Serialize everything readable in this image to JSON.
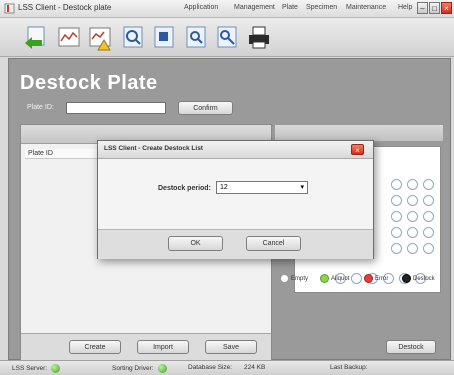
{
  "window": {
    "title": "LSS Client - Destock plate",
    "menu": [
      "Application",
      "Management",
      "Plate",
      "Specimen",
      "Maintenance",
      "Help"
    ],
    "controls": [
      "minimize",
      "maximize",
      "close"
    ]
  },
  "toolbar": {
    "buttons": [
      {
        "icon": "back-icon",
        "label": "Back"
      },
      {
        "icon": "plate-chart-icon",
        "label": "Plate chart"
      },
      {
        "icon": "plate-warning-icon",
        "label": "Plate warning"
      },
      {
        "icon": "search-plate-icon",
        "label": "Search plate"
      },
      {
        "icon": "search-specimen-icon",
        "label": "Search specimen"
      },
      {
        "icon": "search-list-icon",
        "label": "Search list"
      },
      {
        "icon": "search-report-icon",
        "label": "Search report"
      },
      {
        "icon": "printer-icon",
        "label": "Print"
      }
    ]
  },
  "page": {
    "title": "Destock Plate",
    "plate_id_label": "Plate ID:",
    "plate_id_value": "",
    "confirm_label": "Confirm"
  },
  "list": {
    "column_header": "Plate ID",
    "buttons": {
      "create": "Create",
      "import": "Import",
      "save": "Save"
    }
  },
  "plate_view": {
    "legend": [
      {
        "label": "Empty",
        "color": "#ffffff"
      },
      {
        "label": "Aliquot",
        "color": "#8fd14f"
      },
      {
        "label": "Error",
        "color": "#e04040"
      },
      {
        "label": "Destock",
        "color": "#222222"
      }
    ],
    "destock_button": "Destock"
  },
  "dialog": {
    "title": "LSS Client - Create Destock List",
    "destock_period_label": "Destock period:",
    "destock_period_value": "12",
    "ok_label": "OK",
    "cancel_label": "Cancel"
  },
  "status": {
    "lss_server": "LSS Server:",
    "sorting_driver": "Sorting Driver:",
    "database_size": "Database Size:",
    "database_size_value": "224 KB",
    "last_backup": "Last Backup:",
    "ok_color": "#3aa21d"
  }
}
